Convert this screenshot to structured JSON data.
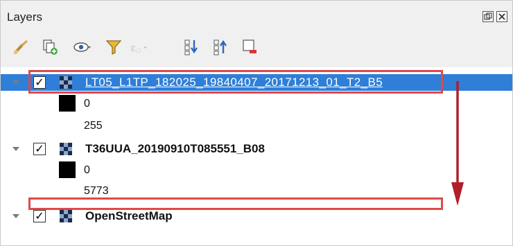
{
  "panel": {
    "title": "Layers",
    "window_buttons": [
      "restore-icon",
      "close-icon"
    ]
  },
  "toolbar": {
    "buttons": [
      {
        "name": "style-manager-icon"
      },
      {
        "name": "add-group-icon"
      },
      {
        "name": "manage-visibility-icon"
      },
      {
        "name": "filter-legend-icon"
      },
      {
        "name": "filter-expression-icon"
      },
      {
        "name": "expand-all-icon"
      },
      {
        "name": "collapse-all-icon"
      },
      {
        "name": "remove-layer-icon"
      }
    ]
  },
  "layers": [
    {
      "name": "LT05_L1TP_182025_19840407_20171213_01_T2_B5",
      "checked": true,
      "selected": true,
      "legend_min": "0",
      "legend_max": "255"
    },
    {
      "name": "T36UUA_20190910T085551_B08",
      "checked": true,
      "selected": false,
      "legend_min": "0",
      "legend_max": "5773"
    },
    {
      "name": "OpenStreetMap",
      "checked": true,
      "selected": false
    }
  ],
  "colors": {
    "selection": "#2f7fd8",
    "highlight": "#e0484b",
    "arrow": "#b01e2a"
  }
}
